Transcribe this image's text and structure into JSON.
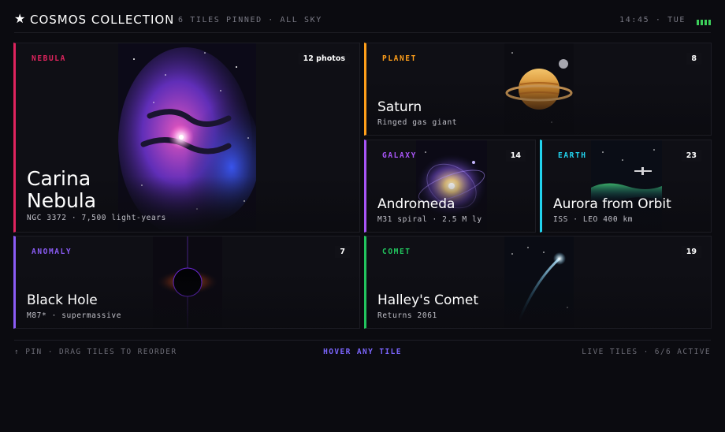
{
  "header": {
    "title": "COSMOS COLLECTION",
    "subtitle": "6 TILES PINNED · ALL SKY",
    "time": "14:45 · TUE",
    "star_icon": "star-icon",
    "battery_icon": "battery-icon"
  },
  "tiles": [
    {
      "category": "NEBULA",
      "count": "12 photos",
      "title_line1": "Carina",
      "title_line2": "Nebula",
      "subtitle": "NGC 3372 · 7,500 light-years",
      "accent": "#e0245e"
    },
    {
      "category": "PLANET",
      "count": "8",
      "title": "Saturn",
      "subtitle": "Ringed gas giant",
      "accent": "#ff9f1a"
    },
    {
      "category": "GALAXY",
      "count": "14",
      "title": "Andromeda",
      "subtitle": "M31 spiral · 2.5 M ly",
      "accent": "#a855f7"
    },
    {
      "category": "EARTH",
      "count": "23",
      "title": "Aurora from Orbit",
      "subtitle": "ISS · LEO 400 km",
      "accent": "#22d3ee"
    },
    {
      "category": "ANOMALY",
      "count": "7",
      "title": "Black Hole",
      "subtitle": "M87* · supermassive",
      "accent": "#8b5cf6"
    },
    {
      "category": "COMET",
      "count": "19",
      "title": "Halley's Comet",
      "subtitle": "Returns 2061",
      "accent": "#22c55e"
    }
  ],
  "footer": {
    "left": "↑ PIN · DRAG TILES TO REORDER",
    "center": "HOVER ANY TILE",
    "right": "LIVE TILES · 6/6 ACTIVE"
  }
}
